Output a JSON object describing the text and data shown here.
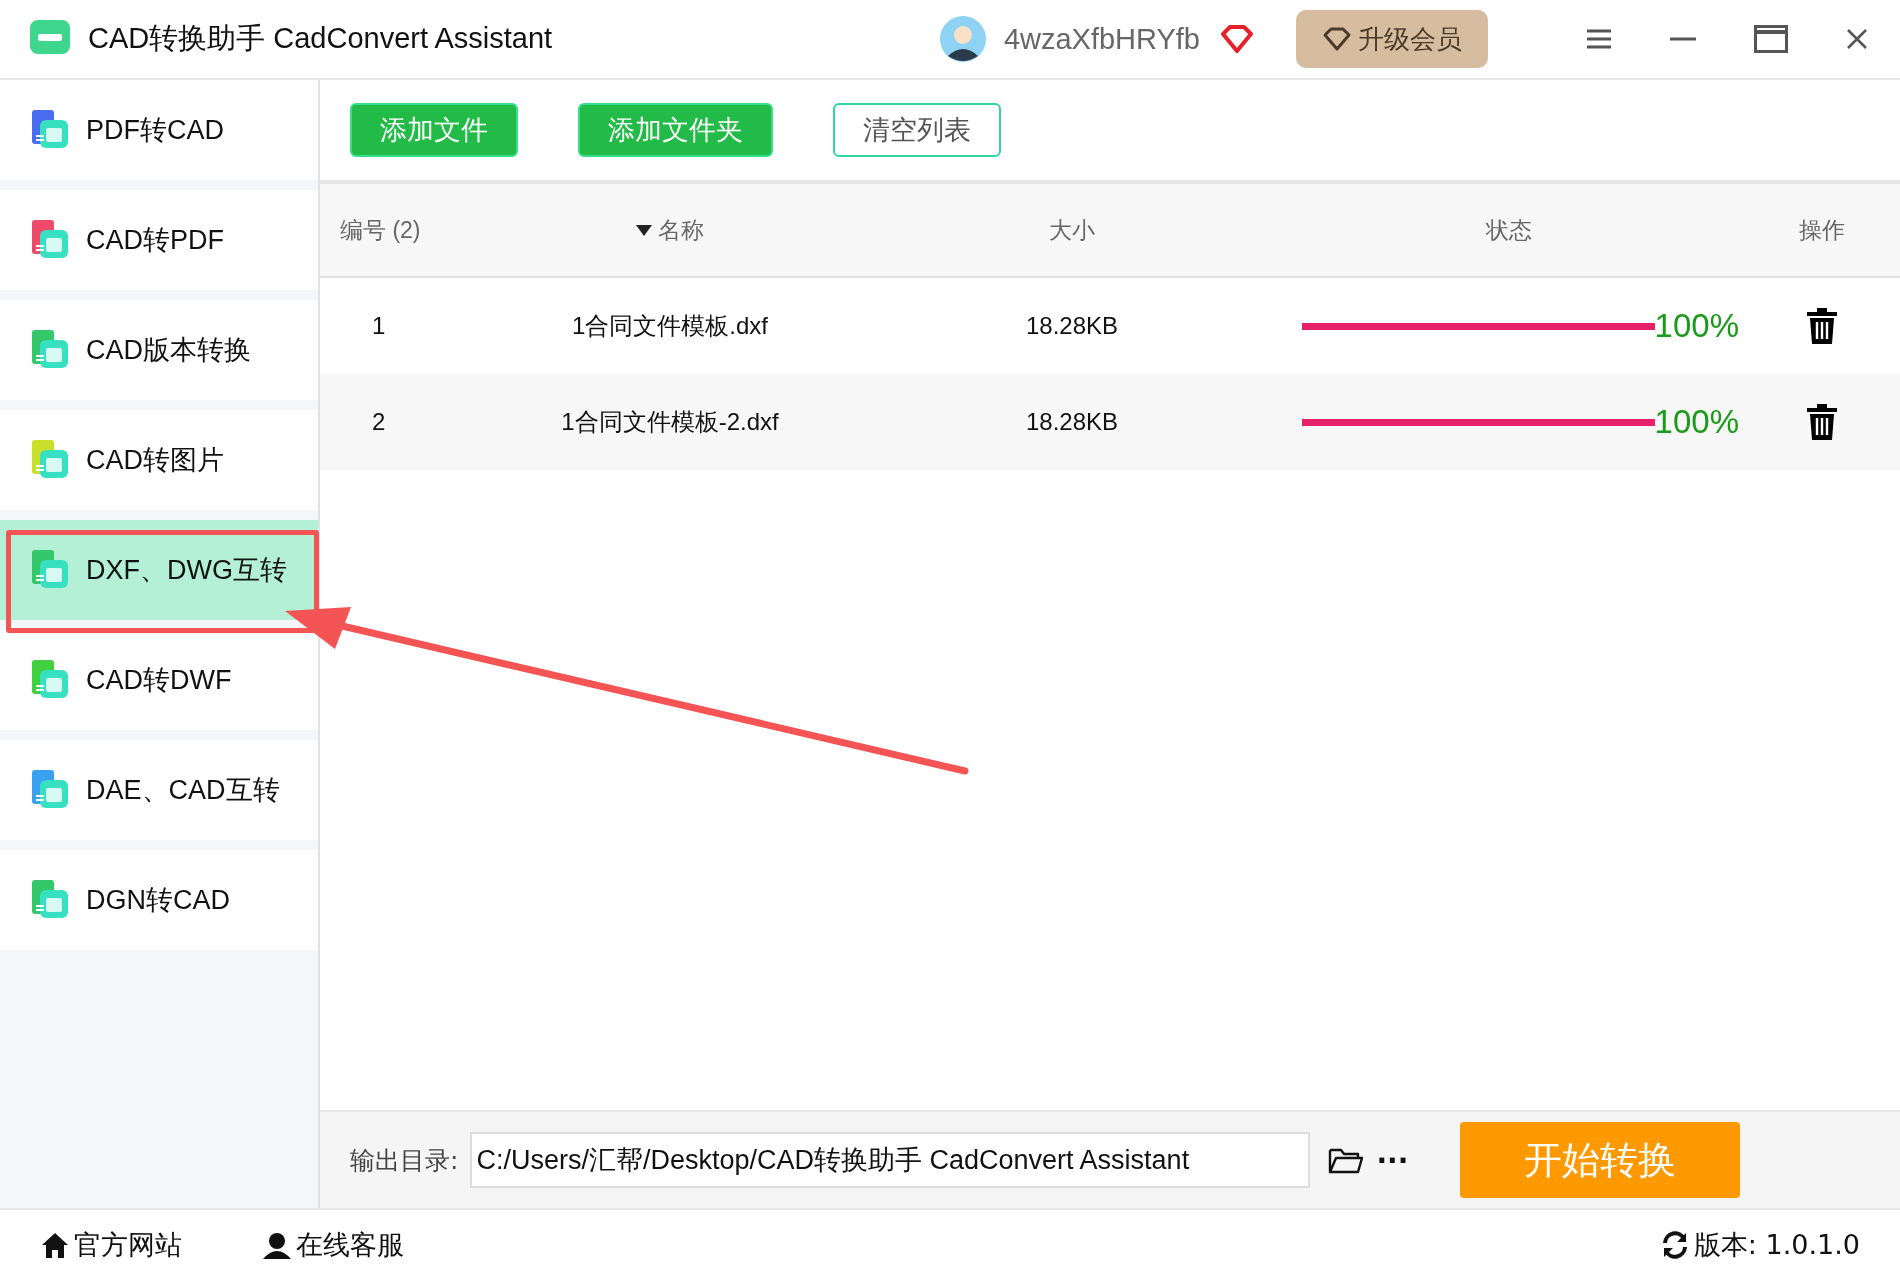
{
  "window": {
    "title": "CAD转换助手 CadConvert Assistant",
    "user": "4wzaXfbHRYfb",
    "upgrade_button": "升级会员"
  },
  "sidebar": {
    "items": [
      {
        "label": "PDF转CAD",
        "selected": false,
        "color": "#4a6cf0"
      },
      {
        "label": "CAD转PDF",
        "selected": false,
        "color": "#f04a6a"
      },
      {
        "label": "CAD版本转换",
        "selected": false,
        "color": "#34c86a"
      },
      {
        "label": "CAD转图片",
        "selected": false,
        "color": "#c8e02a"
      },
      {
        "label": "DXF、DWG互转",
        "selected": true,
        "color": "#34c86a"
      },
      {
        "label": "CAD转DWF",
        "selected": false,
        "color": "#40d040"
      },
      {
        "label": "DAE、CAD互转",
        "selected": false,
        "color": "#3aa0f0"
      },
      {
        "label": "DGN转CAD",
        "selected": false,
        "color": "#34c86a"
      }
    ]
  },
  "toolbar": {
    "buttons": [
      {
        "label": "添加文件",
        "kind": "filled"
      },
      {
        "label": "添加文件夹",
        "kind": "filled"
      },
      {
        "label": "清空列表",
        "kind": "outline"
      }
    ]
  },
  "table": {
    "columns": [
      "编号 (2)",
      "名称",
      "大小",
      "状态",
      "操作"
    ],
    "rows": [
      {
        "number": "1",
        "name": "1合同文件模板.dxf",
        "size": "18.28KB",
        "level": 1,
        "percent": "100%"
      },
      {
        "number": "2",
        "name": "1合同文件模板-2.dxf",
        "size": "18.28KB",
        "level": 1,
        "percent": "100%"
      }
    ]
  },
  "output": {
    "label": "输出目录:",
    "path": "C:/Users/汇帮/Desktop/CAD转换助手 CadConvert Assistant",
    "more": "···",
    "start_button": "开始转换"
  },
  "status_bar": {
    "website": "官方网站",
    "support": "在线客服",
    "version": "版本:  1.0.1.0"
  }
}
